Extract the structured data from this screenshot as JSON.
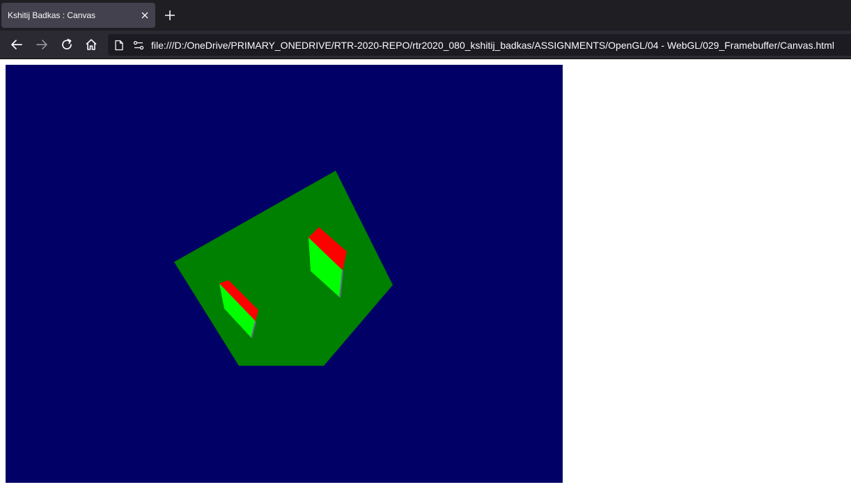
{
  "tab": {
    "title": "Kshitij Badkas : Canvas"
  },
  "address_bar": {
    "url": "file:///D:/OneDrive/PRIMARY_ONEDRIVE/RTR-2020-REPO/rtr2020_080_kshitij_badkas/ASSIGNMENTS/OpenGL/04 - WebGL/029_Framebuffer/Canvas.html"
  },
  "icons": {
    "tab_close": "close-icon",
    "new_tab": "plus-icon",
    "back": "arrow-left-icon",
    "forward": "arrow-right-icon",
    "reload": "reload-icon",
    "home": "home-icon",
    "page": "page-icon",
    "permissions": "permissions-icon"
  },
  "colors": {
    "chrome_dark": "#1f1e23",
    "toolbar": "#2b2a33",
    "canvas_background": "#000066",
    "plane": "#008000",
    "cube_top": "#ff0000",
    "cube_side": "#00ff00"
  }
}
